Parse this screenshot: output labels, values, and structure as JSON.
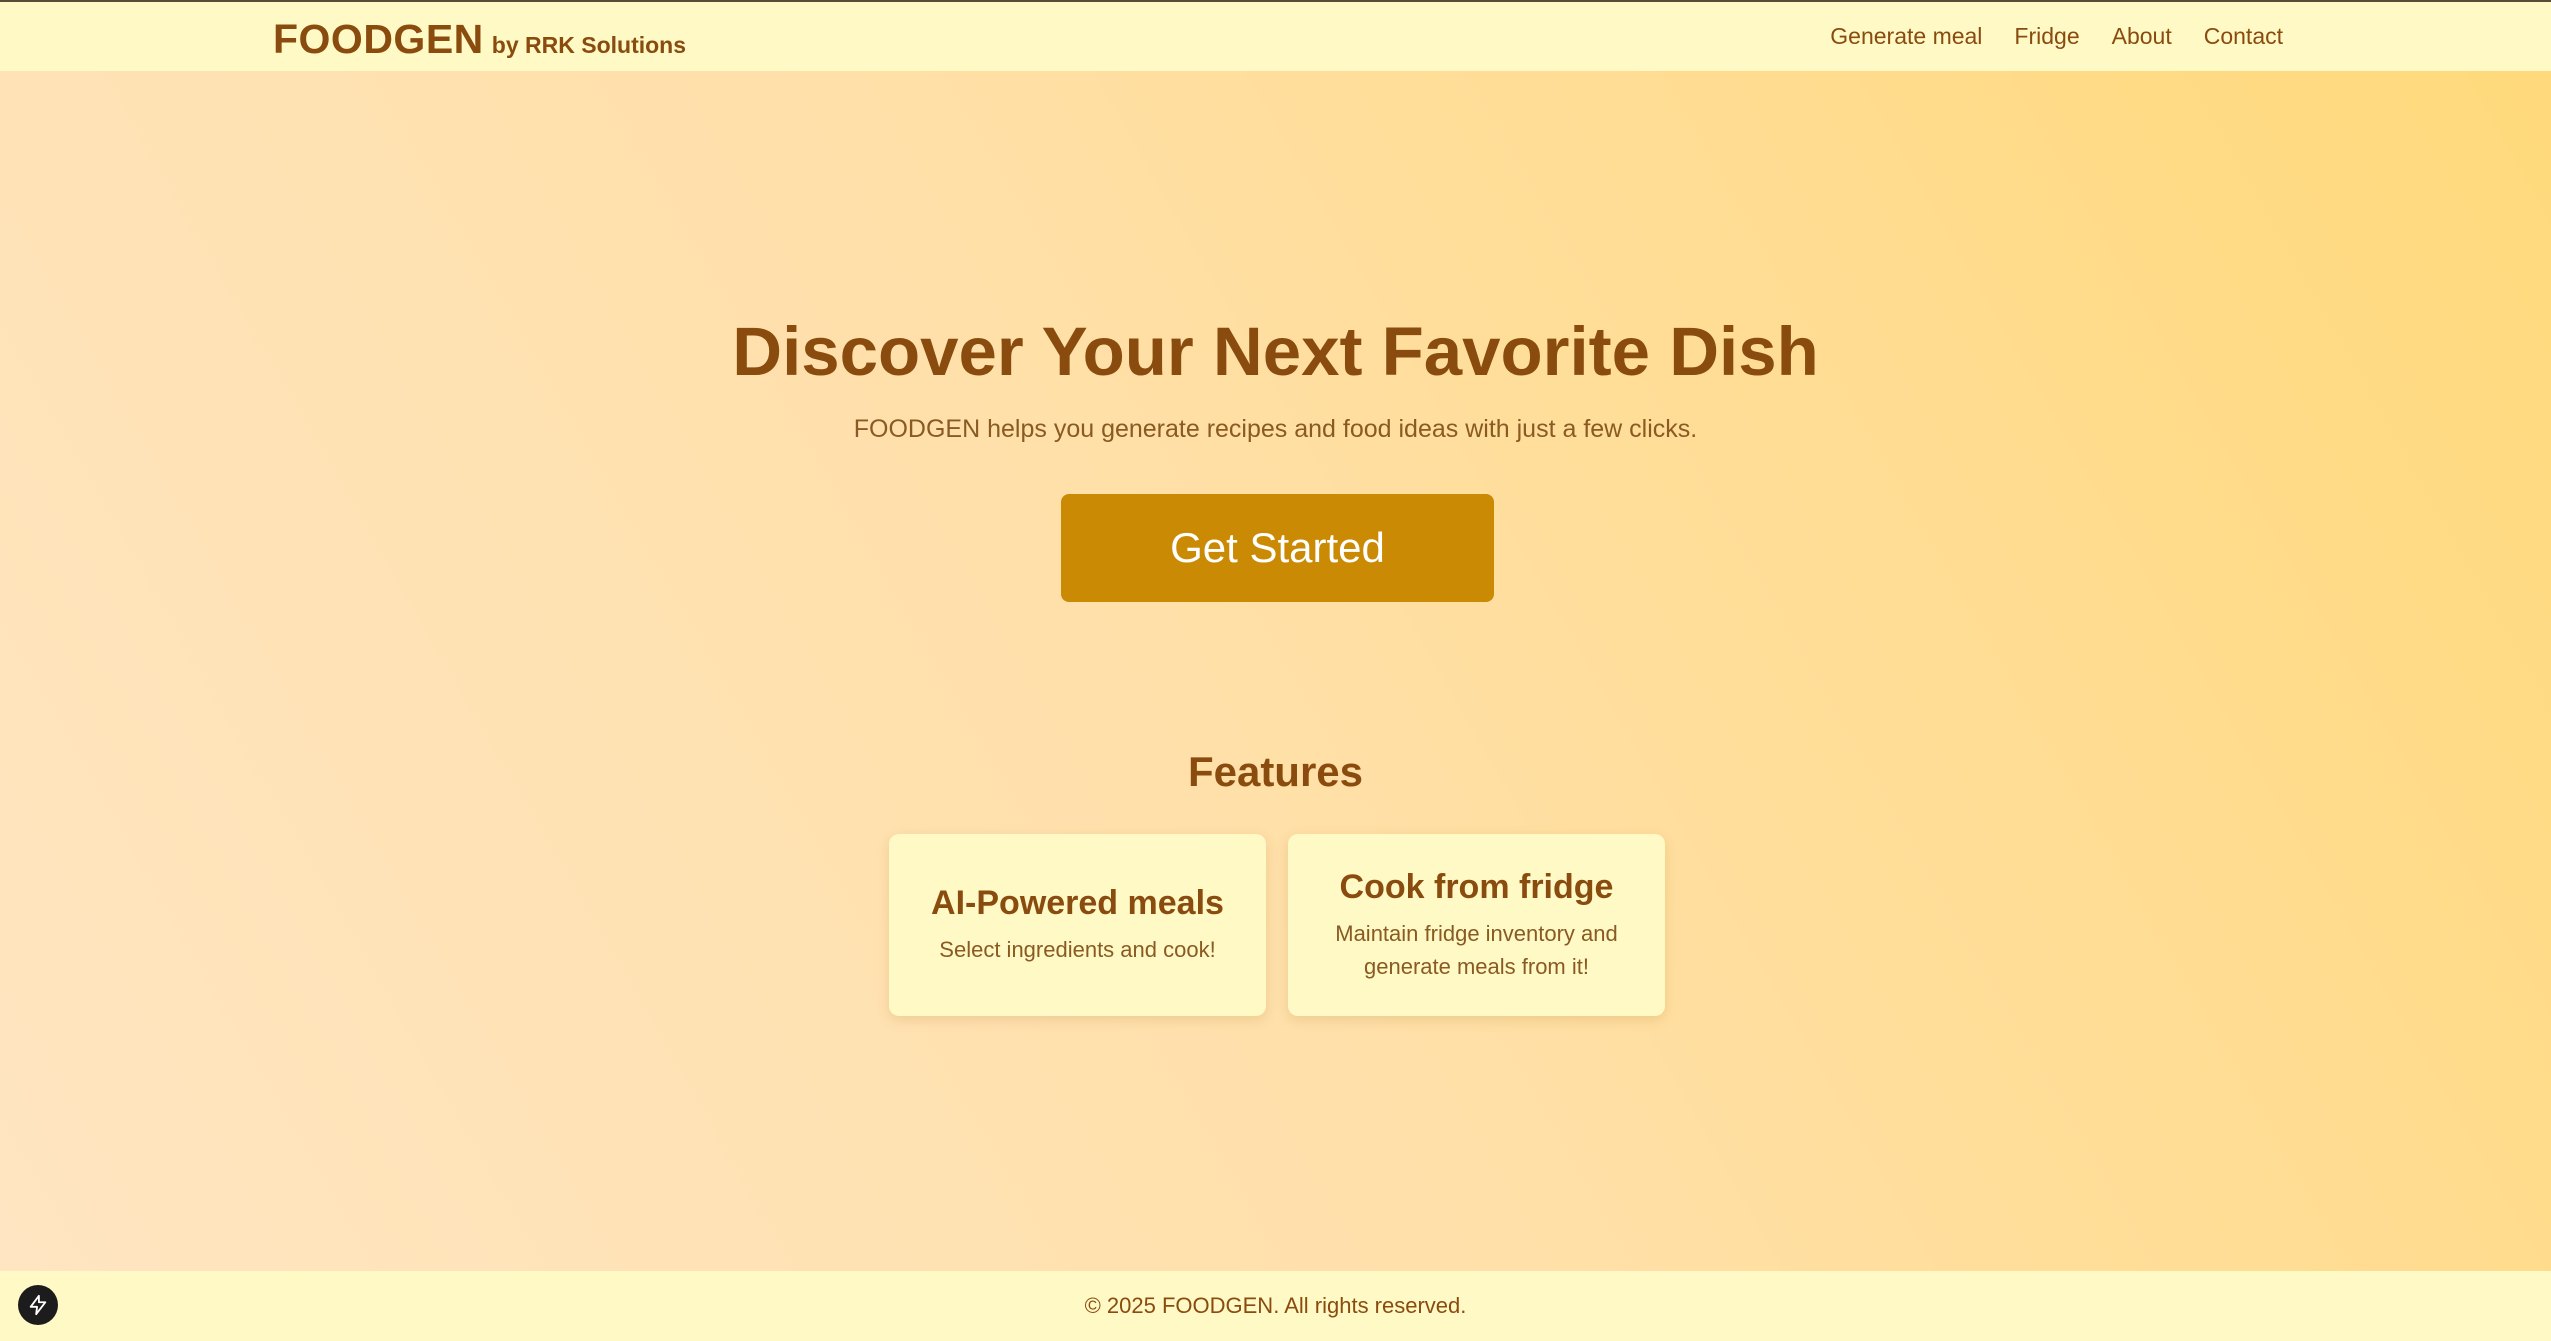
{
  "header": {
    "brand_name": "FOODGEN",
    "brand_by": "by RRK Solutions",
    "nav": [
      {
        "label": "Generate meal"
      },
      {
        "label": "Fridge"
      },
      {
        "label": "About"
      },
      {
        "label": "Contact"
      }
    ]
  },
  "hero": {
    "title": "Discover Your Next Favorite Dish",
    "subtitle": "FOODGEN helps you generate recipes and food ideas with just a few clicks.",
    "cta_label": "Get Started"
  },
  "features": {
    "title": "Features",
    "cards": [
      {
        "title": "AI-Powered meals",
        "description": "Select ingredients and cook!"
      },
      {
        "title": "Cook from fridge",
        "description": "Maintain fridge inventory and generate meals from it!"
      }
    ]
  },
  "footer": {
    "copyright": "© 2025 FOODGEN. All rights reserved."
  },
  "dev_badge": {
    "icon": "lightning-bolt-icon"
  },
  "colors": {
    "brand_text": "#8a4b0f",
    "header_bg": "#fef9c5",
    "cta_bg": "#ca8a04",
    "card_bg": "#fef9c5"
  }
}
